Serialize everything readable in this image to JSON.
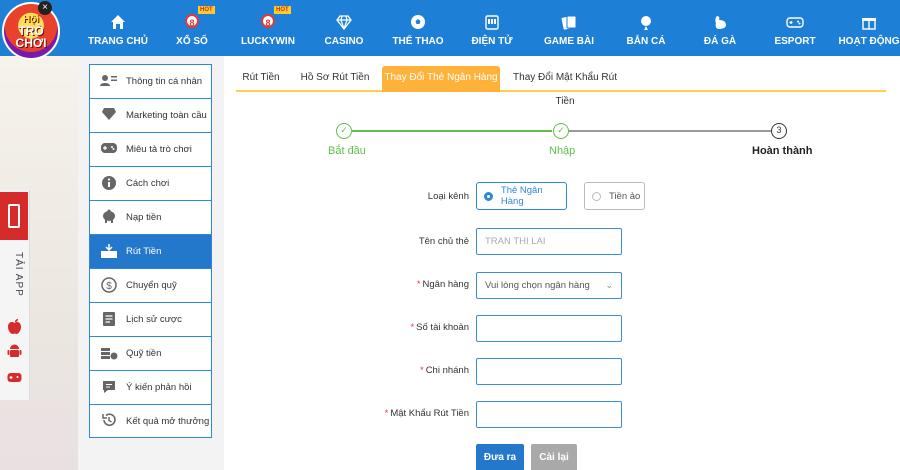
{
  "logo": {
    "line1": "Hội",
    "line2": "TRÒ",
    "line3": "CHƠI",
    "close": "×"
  },
  "nav": [
    {
      "label": "TRANG CHỦ",
      "icon": "home-icon"
    },
    {
      "label": "XỔ SỐ",
      "icon": "lottery-ball-icon",
      "badge": "HOT",
      "num": "8"
    },
    {
      "label": "LUCKYWIN",
      "icon": "lottery-ball-icon",
      "badge": "HOT",
      "num": "8"
    },
    {
      "label": "CASINO",
      "icon": "diamond-icon"
    },
    {
      "label": "THỂ THAO",
      "icon": "soccer-ball-icon"
    },
    {
      "label": "ĐIỆN TỬ",
      "icon": "slot-machine-icon"
    },
    {
      "label": "GAME BÀI",
      "icon": "cards-icon"
    },
    {
      "label": "BẮN CÁ",
      "icon": "fish-icon"
    },
    {
      "label": "ĐÁ GÀ",
      "icon": "rooster-icon"
    },
    {
      "label": "ESPORT",
      "icon": "gamepad-icon"
    },
    {
      "label": "HOẠT ĐỘNG",
      "icon": "gift-icon"
    }
  ],
  "side_app": {
    "label": "TẢI APP"
  },
  "sidebar": [
    {
      "label": "Thông tin cá nhân",
      "icon": "user-card-icon"
    },
    {
      "label": "Marketing toàn cầu",
      "icon": "diamond-icon"
    },
    {
      "label": "Miêu tả trò chơi",
      "icon": "gamepad-icon"
    },
    {
      "label": "Cách chơi",
      "icon": "info-icon"
    },
    {
      "label": "Nạp tiền",
      "icon": "piggy-bank-icon"
    },
    {
      "label": "Rút Tiền",
      "icon": "withdraw-icon",
      "active": true
    },
    {
      "label": "Chuyển quỹ",
      "icon": "dollar-circle-icon"
    },
    {
      "label": "Lịch sử cược",
      "icon": "document-icon"
    },
    {
      "label": "Quỹ tiền",
      "icon": "coins-icon"
    },
    {
      "label": "Ý kiến phản hồi",
      "icon": "chat-icon"
    },
    {
      "label": "Kết quả mở thưởng",
      "icon": "history-icon"
    }
  ],
  "tabs": [
    {
      "label": "Rút Tiền"
    },
    {
      "label": "Hồ Sơ Rút Tiền"
    },
    {
      "label": "Thay Đổi Thẻ Ngân Hàng",
      "active": true
    },
    {
      "label": "Thay Đổi Mật Khẩu Rút Tiền"
    }
  ],
  "steps": [
    {
      "label": "Bắt đầu",
      "mark": "✓",
      "status": "done"
    },
    {
      "label": "Nhập",
      "mark": "✓",
      "status": "done"
    },
    {
      "label": "Hoàn thành",
      "mark": "3",
      "status": "current"
    }
  ],
  "form": {
    "channel_label": "Loại kênh",
    "channel_options": [
      {
        "label": "Thẻ Ngân Hàng",
        "selected": true
      },
      {
        "label": "Tiền ảo",
        "selected": false
      }
    ],
    "holder_label": "Tên chủ thẻ",
    "holder_value": "TRAN THI LAI",
    "bank_label": "Ngân hàng",
    "bank_placeholder": "Vui lòng chọn ngân hàng",
    "account_label": "Số tài khoản",
    "account_value": "",
    "branch_label": "Chi nhánh",
    "branch_value": "",
    "password_label": "Mật Khẩu Rút Tiền",
    "password_value": "",
    "required_mark": "*",
    "submit_label": "Đưa ra",
    "reset_label": "Cài lại"
  },
  "colors": {
    "nav_bg": "#1e7fd6",
    "active_item": "#2478cb",
    "tab_active": "#ffb23a",
    "step_done": "#5fbf4a",
    "submit_btn": "#2478cb",
    "reset_btn": "#a9a9a9"
  }
}
